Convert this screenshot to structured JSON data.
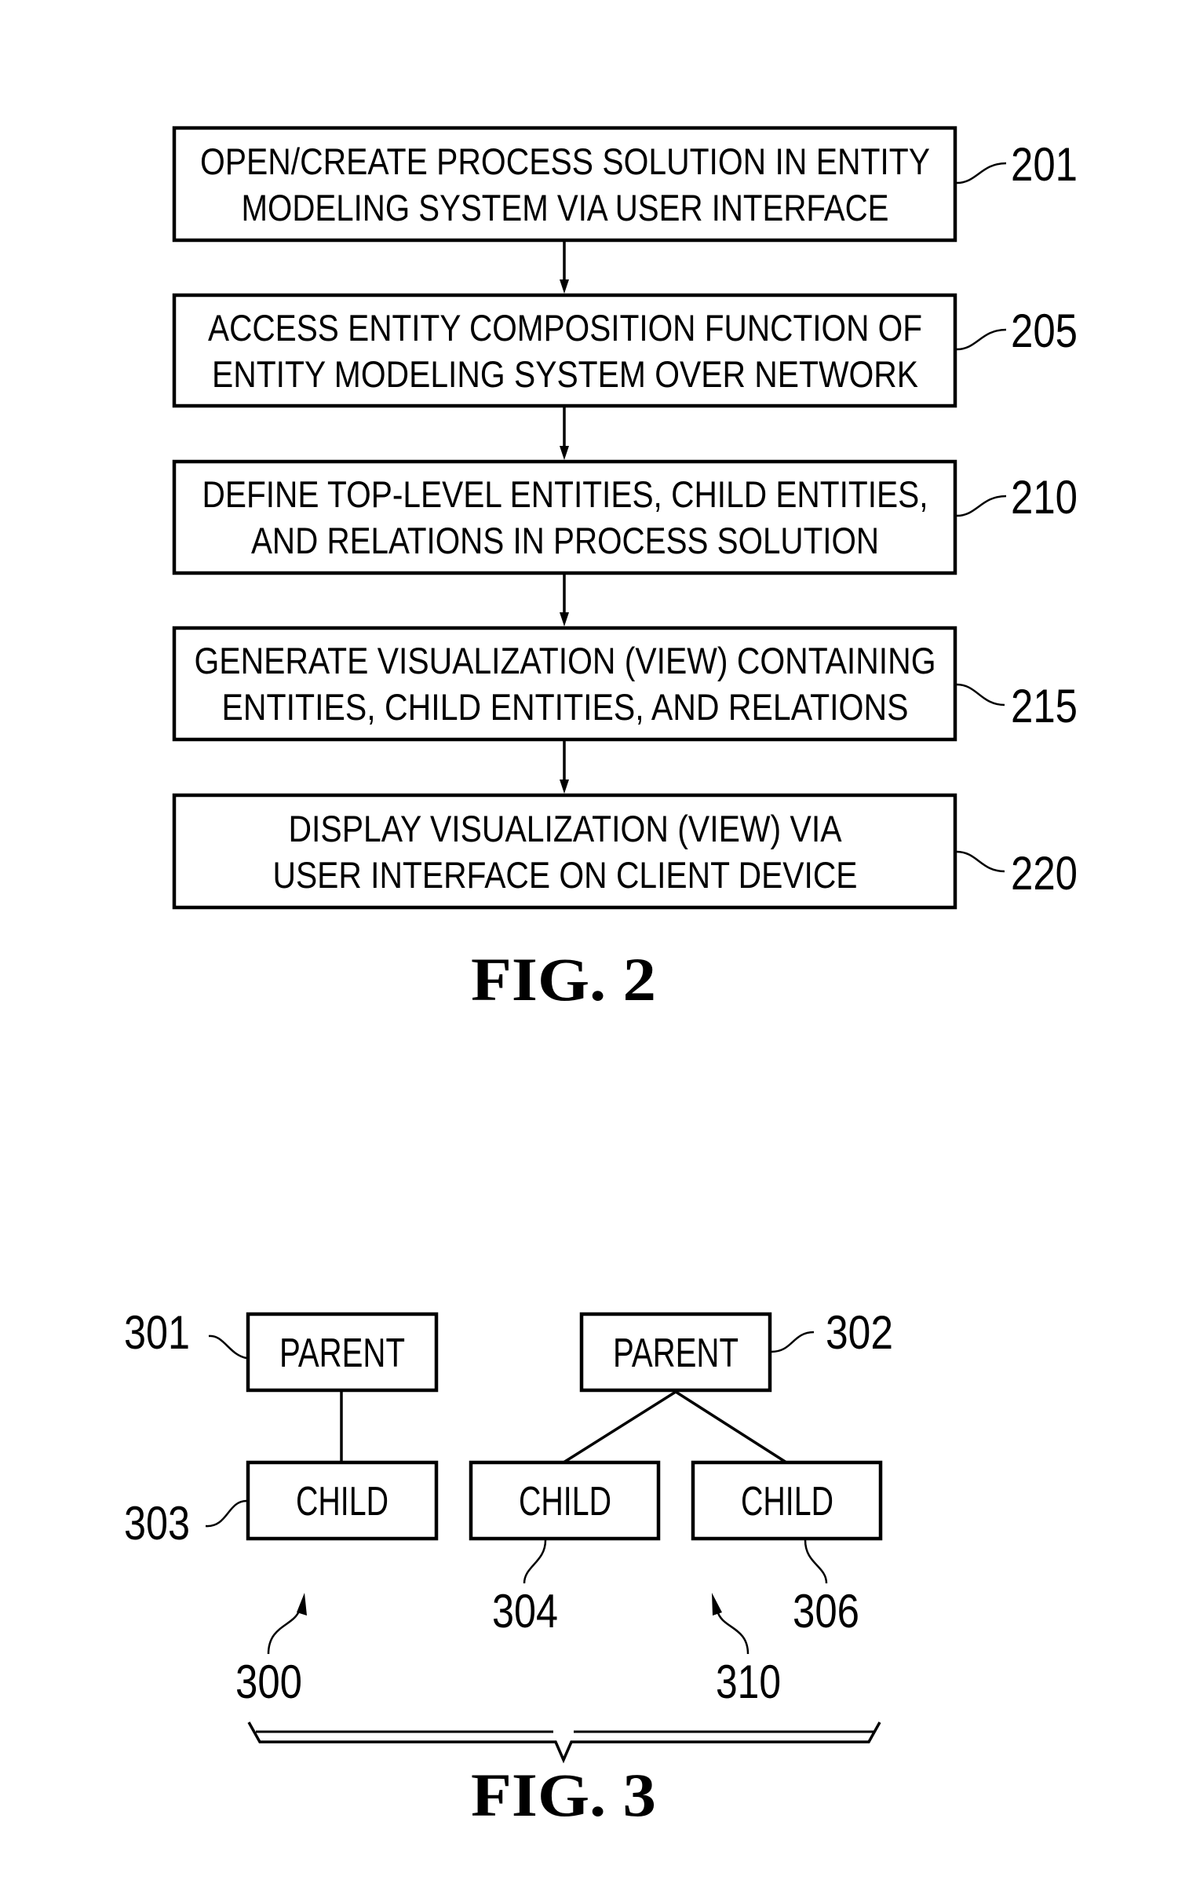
{
  "fig2": {
    "caption": "FIG. 2",
    "steps": [
      {
        "ref": "201",
        "lines": [
          "OPEN/CREATE PROCESS SOLUTION IN ENTITY",
          "MODELING SYSTEM VIA USER INTERFACE"
        ]
      },
      {
        "ref": "205",
        "lines": [
          "ACCESS ENTITY COMPOSITION FUNCTION OF",
          "ENTITY MODELING SYSTEM OVER NETWORK"
        ]
      },
      {
        "ref": "210",
        "lines": [
          "DEFINE TOP-LEVEL ENTITIES, CHILD ENTITIES,",
          "AND RELATIONS IN PROCESS SOLUTION"
        ]
      },
      {
        "ref": "215",
        "lines": [
          "GENERATE VISUALIZATION (VIEW) CONTAINING",
          "ENTITIES, CHILD ENTITIES, AND RELATIONS"
        ]
      },
      {
        "ref": "220",
        "lines": [
          "DISPLAY VISUALIZATION (VIEW) VIA",
          "USER INTERFACE ON CLIENT DEVICE"
        ]
      }
    ]
  },
  "fig3": {
    "caption": "FIG. 3",
    "group_300": {
      "ref": "300",
      "parent": {
        "ref": "301",
        "label": "PARENT"
      },
      "child": {
        "ref": "303",
        "label": "CHILD"
      }
    },
    "group_310": {
      "ref": "310",
      "parent": {
        "ref": "302",
        "label": "PARENT"
      },
      "children": [
        {
          "ref": "304",
          "label": "CHILD"
        },
        {
          "ref": "306",
          "label": "CHILD"
        }
      ]
    }
  }
}
